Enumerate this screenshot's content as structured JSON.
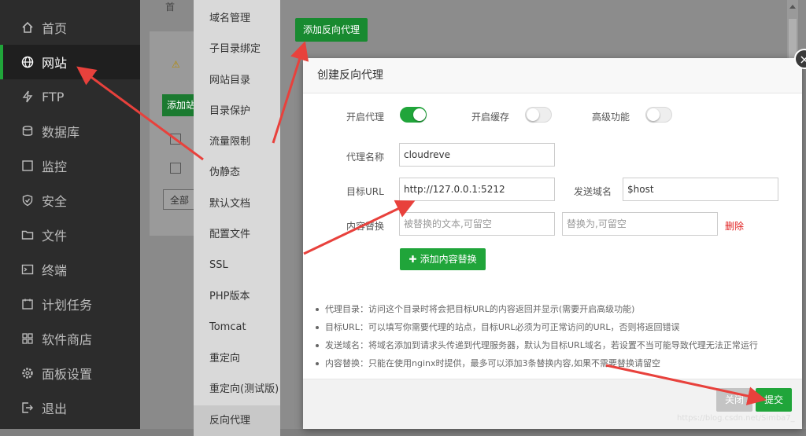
{
  "sidebar": {
    "items": [
      {
        "label": "首页",
        "icon": "home-icon"
      },
      {
        "label": "网站",
        "icon": "globe-icon",
        "active": true
      },
      {
        "label": "FTP",
        "icon": "ftp-icon"
      },
      {
        "label": "数据库",
        "icon": "database-icon"
      },
      {
        "label": "监控",
        "icon": "monitor-icon"
      },
      {
        "label": "安全",
        "icon": "shield-icon"
      },
      {
        "label": "文件",
        "icon": "folder-icon"
      },
      {
        "label": "终端",
        "icon": "terminal-icon"
      },
      {
        "label": "计划任务",
        "icon": "calendar-icon"
      },
      {
        "label": "软件商店",
        "icon": "grid-icon"
      },
      {
        "label": "面板设置",
        "icon": "gear-icon"
      },
      {
        "label": "退出",
        "icon": "logout-icon"
      }
    ]
  },
  "background": {
    "home_crumb": "首",
    "add_site_btn": "添加站",
    "select_value": "全部分"
  },
  "submenu": {
    "items": [
      "域名管理",
      "子目录绑定",
      "网站目录",
      "目录保护",
      "流量限制",
      "伪静态",
      "默认文档",
      "配置文件",
      "SSL",
      "PHP版本",
      "Tomcat",
      "重定向",
      "重定向(测试版)",
      "反向代理"
    ]
  },
  "add_proxy_button": "添加反向代理",
  "modal": {
    "title": "创建反向代理",
    "toggles": {
      "enable_proxy": {
        "label": "开启代理",
        "on": true
      },
      "enable_cache": {
        "label": "开启缓存",
        "on": false
      },
      "advanced": {
        "label": "高级功能",
        "on": false
      }
    },
    "proxy_name": {
      "label": "代理名称",
      "value": "cloudreve"
    },
    "target_url": {
      "label": "目标URL",
      "value": "http://127.0.0.1:5212"
    },
    "send_domain": {
      "label": "发送域名",
      "value": "$host"
    },
    "content_replace": {
      "label": "内容替换",
      "from_placeholder": "被替换的文本,可留空",
      "to_placeholder": "替换为,可留空",
      "delete_label": "删除"
    },
    "add_replace_button": "添加内容替换",
    "tips": [
      "代理目录：访问这个目录时将会把目标URL的内容返回并显示(需要开启高级功能)",
      "目标URL：可以填写你需要代理的站点，目标URL必须为可正常访问的URL，否则将返回错误",
      "发送域名：将域名添加到请求头传递到代理服务器，默认为目标URL域名，若设置不当可能导致代理无法正常运行",
      "内容替换：只能在使用nginx时提供，最多可以添加3条替换内容,如果不需要替换请留空"
    ],
    "footer": {
      "close_label": "关闭",
      "submit_label": "提交"
    }
  },
  "watermark": "https://blog.csdn.net/Simba7_",
  "colors": {
    "accent": "#20a53a",
    "arrow": "#e8413c",
    "danger": "#e02020"
  }
}
